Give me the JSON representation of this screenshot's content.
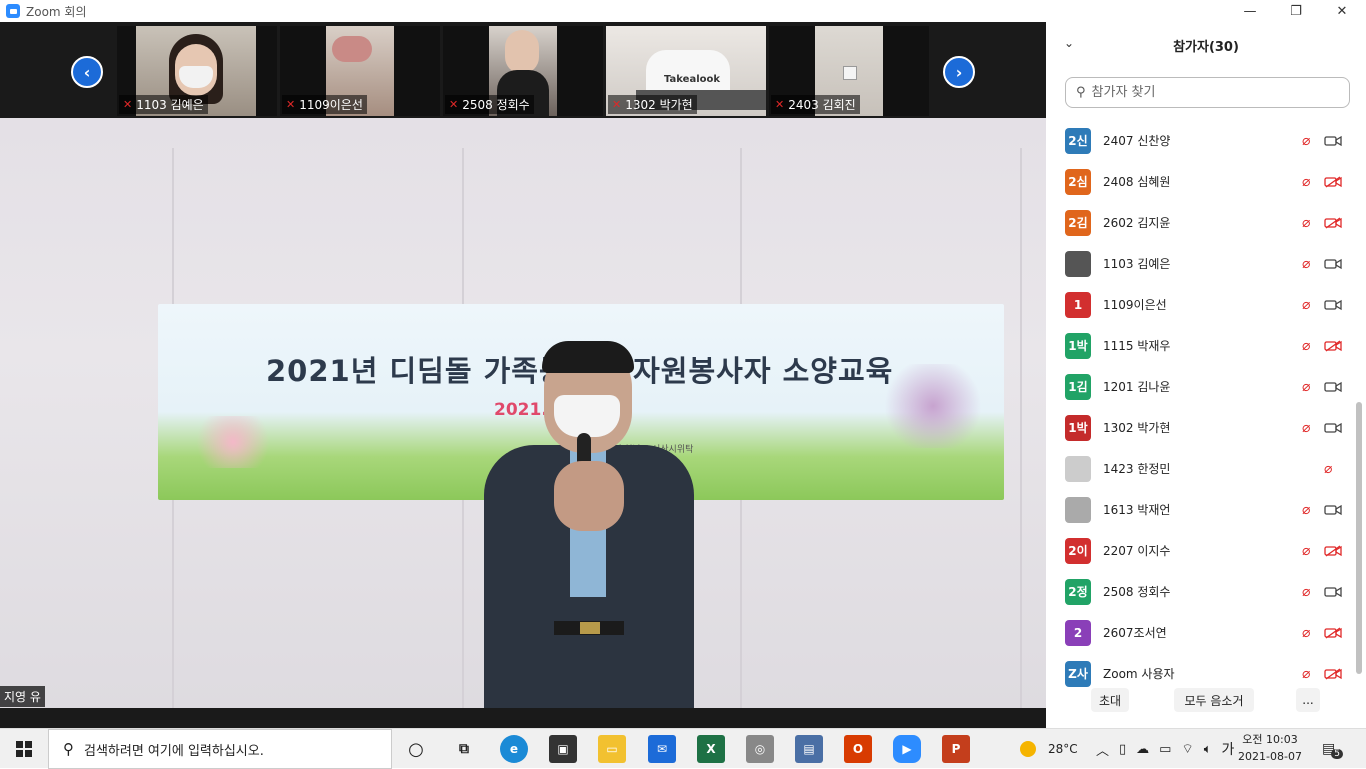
{
  "window": {
    "title": "Zoom 회의",
    "minimize": "—",
    "restore": "❐",
    "close": "✕"
  },
  "thumbnails": [
    {
      "name": "1103 김예은"
    },
    {
      "name": "1109이은선"
    },
    {
      "name": "2508 정회수"
    },
    {
      "name": "1302 박가현"
    },
    {
      "name": "2403 김회진"
    }
  ],
  "nav": {
    "prev": "‹",
    "next": "›"
  },
  "main_video": {
    "speaker_name": "지영 유",
    "banner_title": "2021년 디딤돌 가족봉사단 자원봉사자 소양교육",
    "banner_date": "2021. 10:00",
    "banner_sub": "충청남도 서산시위탁",
    "shirt_text": "Takealook"
  },
  "panel": {
    "title": "참가자(30)",
    "search_placeholder": "참가자 찾기",
    "participants": [
      {
        "avatar": "2신",
        "name": "2407 신찬양",
        "color": "#2e7bb8",
        "cam": "on",
        "mic": "muted"
      },
      {
        "avatar": "2심",
        "name": "2408 심혜원",
        "color": "#e0661c",
        "cam": "off",
        "mic": "muted"
      },
      {
        "avatar": "2김",
        "name": "2602 김지윤",
        "color": "#e0661c",
        "cam": "off",
        "mic": "muted"
      },
      {
        "avatar": "",
        "name": "1103 김예은",
        "color": "#555555",
        "cam": "on",
        "mic": "muted"
      },
      {
        "avatar": "1",
        "name": "1109이은선",
        "color": "#d22f2f",
        "cam": "on",
        "mic": "muted"
      },
      {
        "avatar": "1박",
        "name": "1115 박재우",
        "color": "#21a366",
        "cam": "off",
        "mic": "muted"
      },
      {
        "avatar": "1김",
        "name": "1201 김나윤",
        "color": "#21a366",
        "cam": "on",
        "mic": "muted"
      },
      {
        "avatar": "1박",
        "name": "1302 박가현",
        "color": "#c42b2b",
        "cam": "on",
        "mic": "muted"
      },
      {
        "avatar": "",
        "name": "1423 한정민",
        "color": "#cccccc",
        "cam": "none",
        "mic": "muted"
      },
      {
        "avatar": "",
        "name": "1613 박재언",
        "color": "#aaaaaa",
        "cam": "on",
        "mic": "muted"
      },
      {
        "avatar": "2이",
        "name": "2207 이지수",
        "color": "#d22f2f",
        "cam": "off",
        "mic": "muted"
      },
      {
        "avatar": "2정",
        "name": "2508 정회수",
        "color": "#21a366",
        "cam": "on",
        "mic": "muted"
      },
      {
        "avatar": "2",
        "name": "2607조서연",
        "color": "#8a3fb8",
        "cam": "off",
        "mic": "muted"
      },
      {
        "avatar": "Z사",
        "name": "Zoom 사용자",
        "color": "#2e7bb8",
        "cam": "off",
        "mic": "muted"
      }
    ],
    "buttons": {
      "invite": "초대",
      "mute_all": "모두 음소거",
      "more": "..."
    }
  },
  "taskbar": {
    "search_text": "검색하려면 여기에 입력하십시오.",
    "weather": "28°C",
    "ime": "가",
    "time": "오전 10:03",
    "date": "2021-08-07",
    "notifications": "5"
  }
}
